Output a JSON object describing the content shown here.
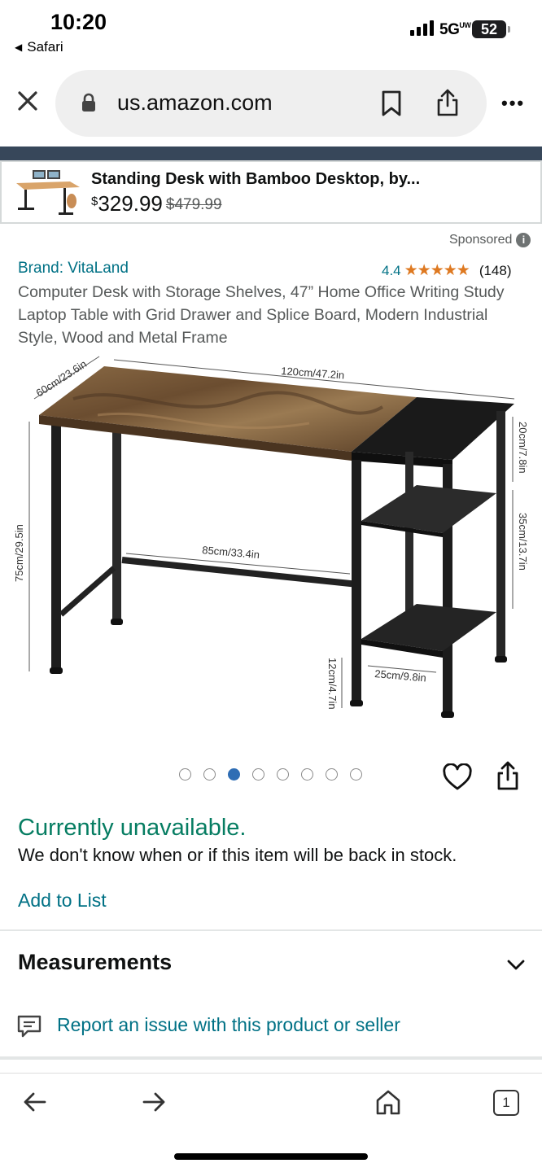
{
  "status_bar": {
    "time": "10:20",
    "back_app": "Safari",
    "network": "5G",
    "network_suffix": "UW",
    "battery": "52"
  },
  "browser": {
    "url": "us.amazon.com",
    "tabs_count": "1",
    "icons": [
      "close-icon",
      "lock-icon",
      "bookmark-icon",
      "share-icon",
      "more-icon",
      "back-arrow-icon",
      "forward-arrow-icon",
      "home-icon",
      "tabs-icon"
    ]
  },
  "mini_product": {
    "title": "Standing Desk with Bamboo Desktop, by...",
    "currency": "$",
    "price": "329.99",
    "old_price": "$479.99"
  },
  "sponsored_label": "Sponsored",
  "product": {
    "brand": "Brand: VitaLand",
    "rating_value": "4.4",
    "rating_stars": 4.4,
    "stars_glyphs": "★★★★★",
    "rating_count": "(148)",
    "description": "Computer Desk with Storage Shelves, 47” Home Office Writing Study Laptop Table with Grid Drawer and Splice Board, Modern Industrial Style, Wood and Metal Frame"
  },
  "image_dimensions": {
    "width": "120cm/47.2in",
    "depth": "60cm/23.6in",
    "height": "75cm/29.5in",
    "leg_span": "85cm/33.4in",
    "top_shelf": "20cm/7.8in",
    "mid_shelf": "35cm/13.7in",
    "bottom_gap": "12cm/4.7in",
    "shelf_width": "25cm/9.8in"
  },
  "carousel": {
    "total": 8,
    "active_index": 2
  },
  "availability": {
    "status": "Currently unavailable.",
    "message": "We don't know when or if this item will be back in stock.",
    "add_to_list": "Add to List"
  },
  "sections": {
    "measurements": "Measurements",
    "report": "Report an issue with this product or seller"
  },
  "colors": {
    "link": "#007185",
    "available_green": "#067d62",
    "star": "#de7921",
    "navy": "#37475a",
    "dot_active": "#2e6db4"
  }
}
